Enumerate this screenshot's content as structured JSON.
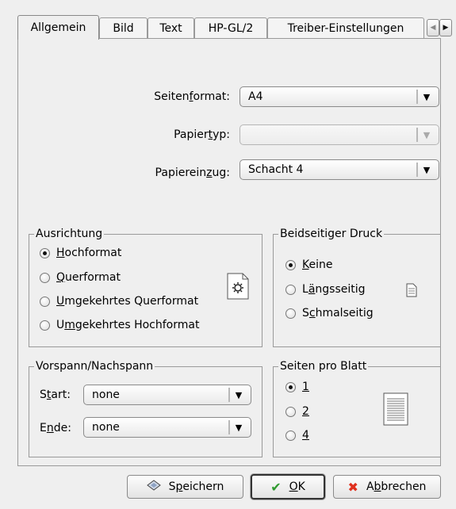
{
  "tabs": [
    "Allgemein",
    "Bild",
    "Text",
    "HP-GL/2",
    "Treiber-Einstellungen"
  ],
  "form": {
    "seitenformat": {
      "label_pre": "Seiten",
      "label_u": "f",
      "label_post": "ormat:",
      "value": "A4"
    },
    "papiertyp": {
      "label_pre": "Papier",
      "label_u": "t",
      "label_post": "yp:",
      "value": ""
    },
    "papiereinzug": {
      "label_pre": "Papierein",
      "label_u": "z",
      "label_post": "ug:",
      "value": "Schacht 4"
    }
  },
  "ausrichtung": {
    "title": "Ausrichtung",
    "options": [
      {
        "u": "H",
        "rest": "ochformat",
        "selected": true
      },
      {
        "u": "Q",
        "rest": "uerformat",
        "selected": false
      },
      {
        "u": "U",
        "rest": "mgekehrtes Querformat",
        "selected": false
      },
      {
        "pre": "U",
        "u": "m",
        "rest": "gekehrtes Hochformat",
        "selected": false
      }
    ]
  },
  "beidseitig": {
    "title": "Beidseitiger Druck",
    "options": [
      {
        "pre": "",
        "u": "K",
        "rest": "eine",
        "selected": true
      },
      {
        "pre": "L",
        "u": "ä",
        "rest": "ngsseitig",
        "selected": false
      },
      {
        "pre": "S",
        "u": "c",
        "rest": "hmalseitig",
        "selected": false
      }
    ]
  },
  "vorspann": {
    "title": "Vorspann/Nachspann",
    "start": {
      "pre": "S",
      "u": "t",
      "post": "art:",
      "value": "none"
    },
    "ende": {
      "pre": "E",
      "u": "n",
      "post": "de:",
      "value": "none"
    }
  },
  "seiten_pro_blatt": {
    "title": "Seiten pro Blatt",
    "options": [
      {
        "u": "1",
        "selected": true
      },
      {
        "u": "2",
        "selected": false
      },
      {
        "u": "4",
        "selected": false
      }
    ]
  },
  "buttons": {
    "save": {
      "pre": "S",
      "u": "p",
      "post": "eichern"
    },
    "ok": {
      "pre": "",
      "u": "O",
      "post": "K"
    },
    "cancel": {
      "pre": "A",
      "u": "b",
      "post": "brechen"
    }
  },
  "icons": {
    "save": "floppy-icon",
    "ok": "checkmark-icon",
    "cancel": "x-icon"
  }
}
